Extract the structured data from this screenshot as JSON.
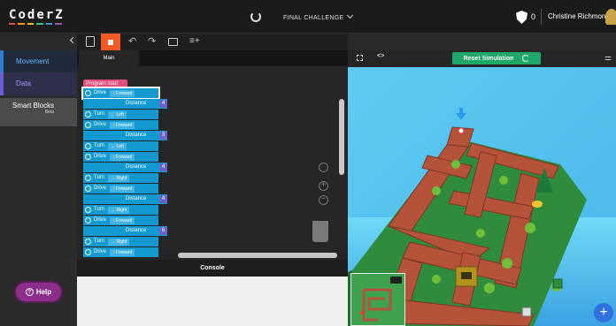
{
  "app": {
    "logo": [
      {
        "ch": "C",
        "color": "#e74c3c"
      },
      {
        "ch": "o",
        "color": "#f39c12"
      },
      {
        "ch": "d",
        "color": "#f1c40f"
      },
      {
        "ch": "e",
        "color": "#2ecc71"
      },
      {
        "ch": "r",
        "color": "#3498db"
      },
      {
        "ch": "Z",
        "color": "#9b59b6"
      }
    ],
    "challenge_title": "FINAL CHALLENGE",
    "score": "0",
    "user_name": "Christine Richmond"
  },
  "categories": {
    "movement": "Movement",
    "data": "Data",
    "smart_blocks": "Smart Blocks",
    "smart_blocks_badge": "Beta"
  },
  "help_label": "Help",
  "editor": {
    "tab_main": "Main",
    "program_start": "Program start",
    "blocks": [
      {
        "kind": "drive",
        "label": "Drive",
        "option": "↑ Forward",
        "distance": "4"
      },
      {
        "kind": "turn",
        "label": "Turn",
        "option": "← Left"
      },
      {
        "kind": "drive",
        "label": "Drive",
        "option": "↑ Forward",
        "distance": "3"
      },
      {
        "kind": "turn",
        "label": "Turn",
        "option": "← Left"
      },
      {
        "kind": "drive",
        "label": "Drive",
        "option": "↑ Forward",
        "distance": "4"
      },
      {
        "kind": "turn",
        "label": "Turn",
        "option": "→ Right"
      },
      {
        "kind": "drive",
        "label": "Drive",
        "option": "↑ Forward",
        "distance": "4"
      },
      {
        "kind": "turn",
        "label": "Turn",
        "option": "→ Right"
      },
      {
        "kind": "drive",
        "label": "Drive",
        "option": "↑ Forward",
        "distance": "6"
      },
      {
        "kind": "turn",
        "label": "Turn",
        "option": "→ Right"
      },
      {
        "kind": "drive",
        "label": "Drive",
        "option": "↑ Forward"
      }
    ],
    "distance_label": "Distance"
  },
  "console_label": "Console",
  "simulation": {
    "reset_label": "Reset Simulation"
  },
  "colors": {
    "accent_orange": "#f15a24",
    "block_blue": "#139ad0",
    "start_pink": "#e34d7c",
    "reset_green": "#1fa86a",
    "help_purple": "#8b2f8b"
  }
}
